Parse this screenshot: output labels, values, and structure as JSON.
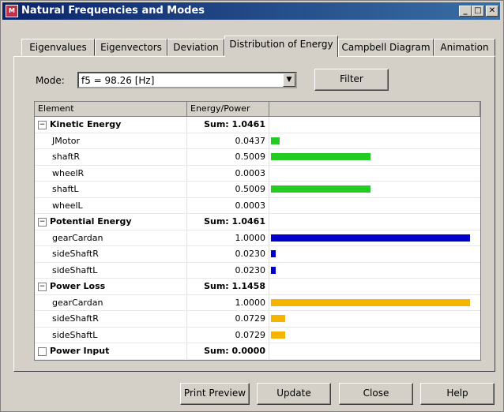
{
  "window": {
    "title": "Natural Frequencies and Modes",
    "icon": "app-logo-icon",
    "controls": [
      "minimize-icon",
      "maximize-icon",
      "close-icon"
    ],
    "control_glyphs": {
      "minimize": "_",
      "maximize": "□",
      "close": "✕"
    }
  },
  "tabs": [
    {
      "label": "Eigenvalues"
    },
    {
      "label": "Eigenvectors"
    },
    {
      "label": "Deviation"
    },
    {
      "label": "Distribution of Energy",
      "active": true
    },
    {
      "label": "Campbell Diagram"
    },
    {
      "label": "Animation"
    }
  ],
  "mode": {
    "label": "Mode:",
    "selected": "f5 = 98.26 [Hz]",
    "arrow": "▼"
  },
  "filter_button": "Filter",
  "grid": {
    "columns": [
      "Element",
      "Energy/Power"
    ],
    "rows": [
      {
        "kind": "group",
        "expander": "−",
        "name": "Kinetic Energy",
        "value": "Sum: 1.0461"
      },
      {
        "kind": "child",
        "name": "JMotor",
        "value": "0.0437",
        "fraction": 0.0437,
        "color": "#22cc22"
      },
      {
        "kind": "child",
        "name": "shaftR",
        "value": "0.5009",
        "fraction": 0.5009,
        "color": "#22cc22"
      },
      {
        "kind": "child",
        "name": "wheelR",
        "value": "0.0003",
        "fraction": 0.0003,
        "color": "#22cc22"
      },
      {
        "kind": "child",
        "name": "shaftL",
        "value": "0.5009",
        "fraction": 0.5009,
        "color": "#22cc22"
      },
      {
        "kind": "child",
        "name": "wheelL",
        "value": "0.0003",
        "fraction": 0.0003,
        "color": "#22cc22"
      },
      {
        "kind": "group",
        "expander": "−",
        "name": "Potential Energy",
        "value": "Sum: 1.0461"
      },
      {
        "kind": "child",
        "name": "gearCardan",
        "value": "1.0000",
        "fraction": 1.0,
        "color": "#0000cc"
      },
      {
        "kind": "child",
        "name": "sideShaftR",
        "value": "0.0230",
        "fraction": 0.023,
        "color": "#0000cc"
      },
      {
        "kind": "child",
        "name": "sideShaftL",
        "value": "0.0230",
        "fraction": 0.023,
        "color": "#0000cc"
      },
      {
        "kind": "group",
        "expander": "−",
        "name": "Power Loss",
        "value": "Sum: 1.1458"
      },
      {
        "kind": "child",
        "name": "gearCardan",
        "value": "1.0000",
        "fraction": 1.0,
        "color": "#f5b400"
      },
      {
        "kind": "child",
        "name": "sideShaftR",
        "value": "0.0729",
        "fraction": 0.0729,
        "color": "#f5b400"
      },
      {
        "kind": "child",
        "name": "sideShaftL",
        "value": "0.0729",
        "fraction": 0.0729,
        "color": "#f5b400"
      },
      {
        "kind": "group",
        "expander": "",
        "name": "Power Input",
        "value": "Sum: 0.0000"
      }
    ]
  },
  "buttons": {
    "print_preview": "Print Preview",
    "update": "Update",
    "close": "Close",
    "help": "Help"
  }
}
